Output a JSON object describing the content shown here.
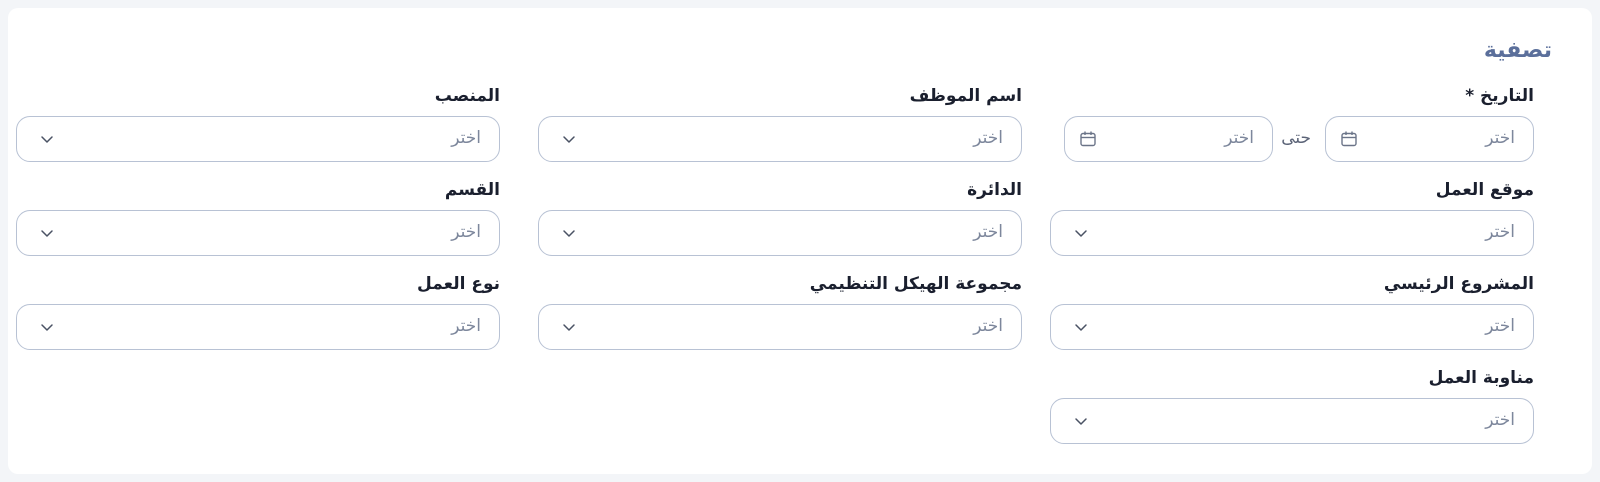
{
  "filter": {
    "title": "تصفية",
    "placeholder": "اختر",
    "date": {
      "label": "التاريخ *",
      "until": "حتى"
    },
    "fields": {
      "position": "المنصب",
      "employee_name": "اسم الموظف",
      "work_location": "موقع العمل",
      "department": "الدائرة",
      "section": "القسم",
      "main_project": "المشروع الرئيسي",
      "org_structure_group": "مجموعة الهيكل التنظيمي",
      "work_type": "نوع العمل",
      "work_shift": "مناوبة العمل"
    }
  },
  "icons": {
    "dropdown": "chevron-down-icon",
    "date": "calendar-icon"
  },
  "colors": {
    "title": "#5b6f9b",
    "border": "#b8c2d4",
    "placeholder": "#7d879c"
  }
}
